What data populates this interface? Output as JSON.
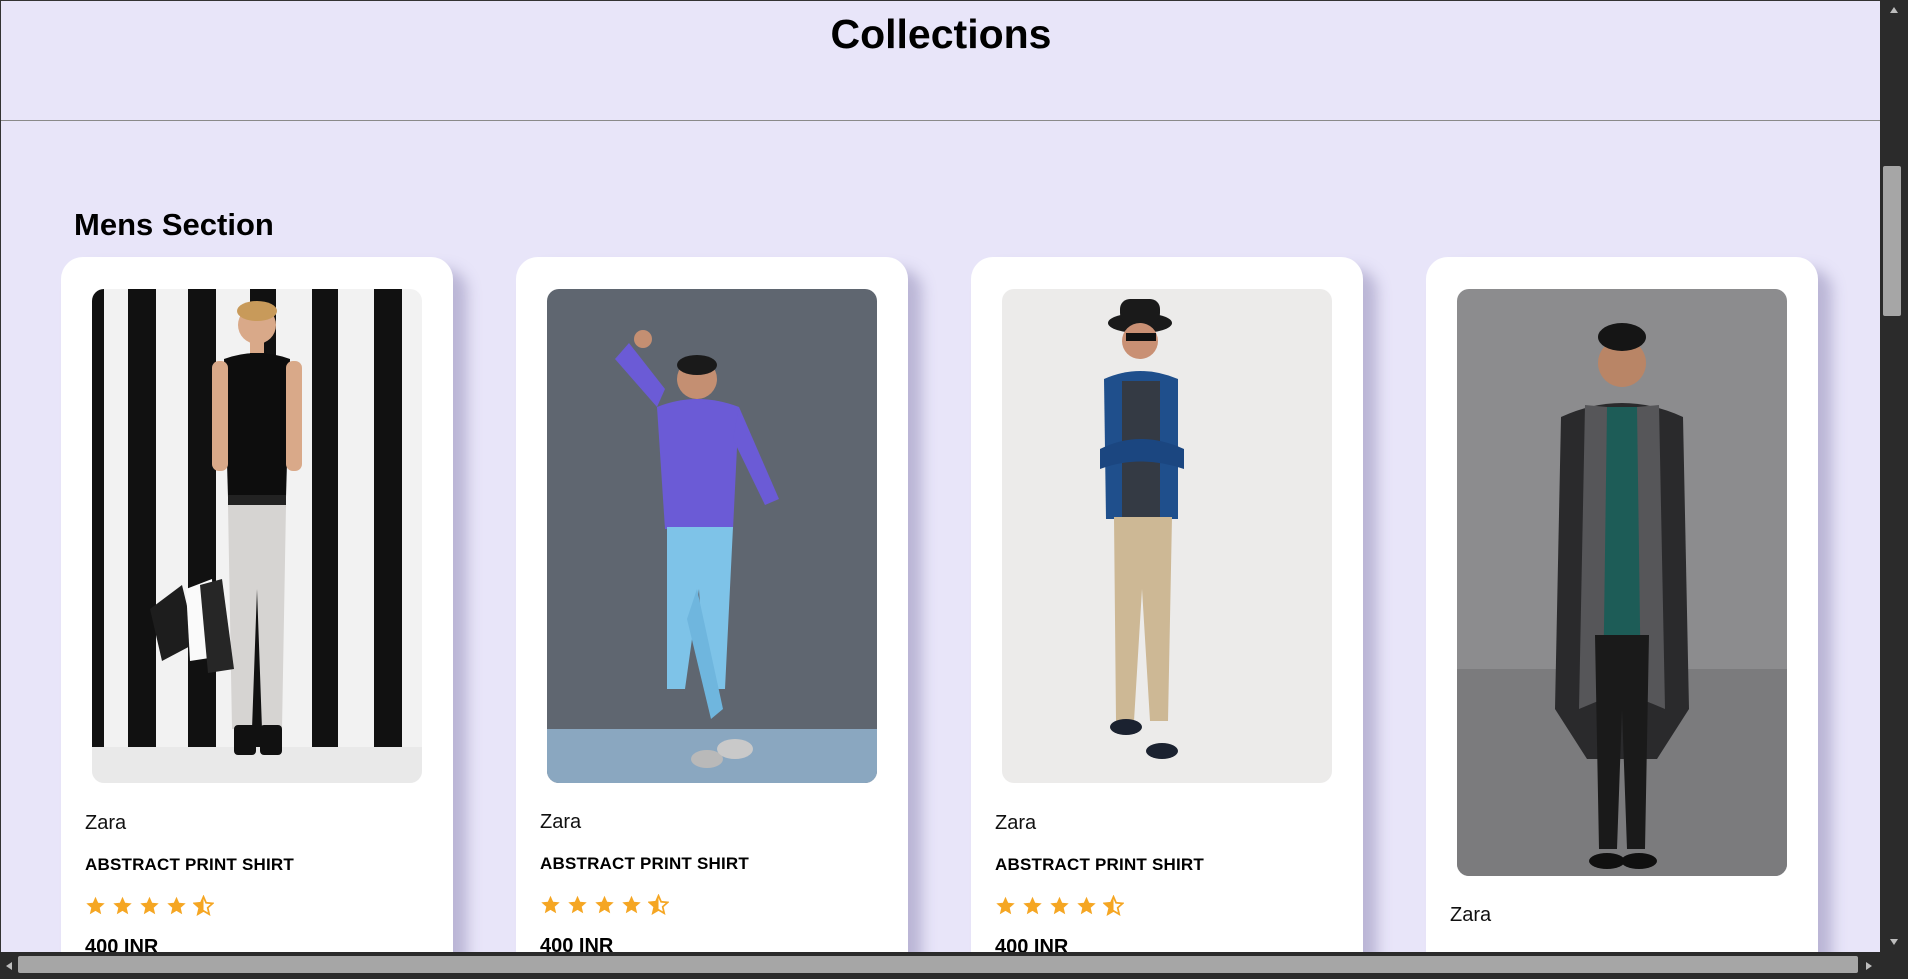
{
  "page": {
    "title": "Collections",
    "section_title": "Mens Section"
  },
  "colors": {
    "background": "#e8e5f9",
    "card": "#ffffff",
    "star": "#f5a623"
  },
  "products": [
    {
      "brand": "Zara",
      "name": "ABSTRACT PRINT SHIRT",
      "rating": 4.5,
      "price": "400 INR",
      "image": "man-in-black-tshirt-with-shopping-bags"
    },
    {
      "brand": "Zara",
      "name": "ABSTRACT PRINT SHIRT",
      "rating": 4.5,
      "price": "400 INR",
      "image": "man-in-purple-sweater-light-blue-jeans"
    },
    {
      "brand": "Zara",
      "name": "ABSTRACT PRINT SHIRT",
      "rating": 4.5,
      "price": "400 INR",
      "image": "man-in-hat-denim-shirt-khaki-pants"
    },
    {
      "brand": "Zara",
      "image": "man-in-long-black-coat-teal-shirt"
    }
  ],
  "icons": {
    "star": "star-icon",
    "half_star": "star-half-icon",
    "scroll_up": "arrow-up-icon",
    "scroll_down": "arrow-down-icon",
    "scroll_left": "arrow-left-icon",
    "scroll_right": "arrow-right-icon"
  }
}
